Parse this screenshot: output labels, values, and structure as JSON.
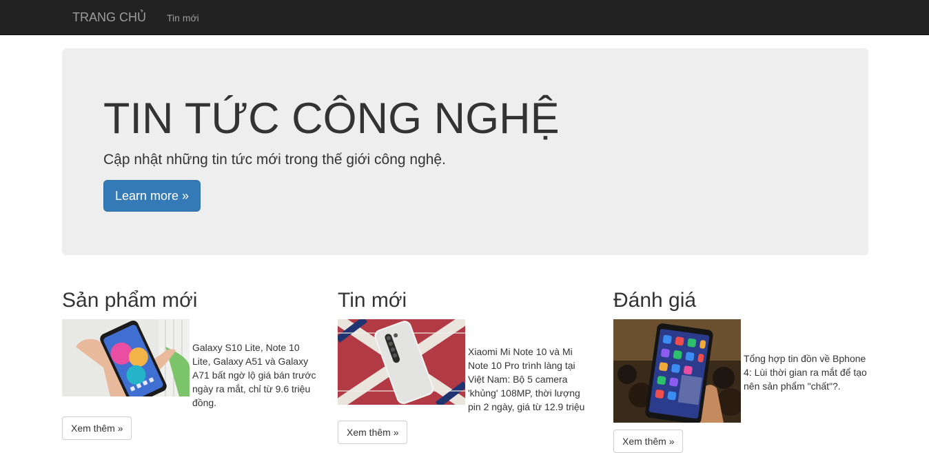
{
  "nav": {
    "brand": "TRANG CHỦ",
    "links": [
      "Tin mới"
    ]
  },
  "hero": {
    "title": "TIN TỨC CÔNG NGHỆ",
    "lead": "Cập nhật những tin tức mới trong thế giới công nghệ.",
    "button": "Learn more »"
  },
  "columns": [
    {
      "heading": "Sản phẩm mới",
      "text": "Galaxy S10 Lite, Note 10 Lite, Galaxy A51 và Galaxy A71 bất ngờ lộ giá bán trước ngày ra mắt, chỉ từ 9.6 triệu đồng.",
      "button": "Xem thêm »",
      "image_icon": "phone-in-hand-photo"
    },
    {
      "heading": "Tin mới",
      "text": "Xiaomi Mi Note 10 và Mi Note 10 Pro trình làng tại Việt Nam: Bộ 5 camera 'khủng' 108MP, thời lượng pin 2 ngày, giá từ 12.9 triệu",
      "button": "Xem thêm »",
      "image_icon": "phone-on-flag-photo"
    },
    {
      "heading": "Đánh giá",
      "text": "Tổng hợp tin đồn về Bphone 4: Lùi thời gian ra mắt để tạo nên sản phẩm \"chất\"?.",
      "button": "Xem thêm »",
      "image_icon": "phone-at-event-photo"
    }
  ],
  "colors": {
    "navbar": "#222222",
    "nav_text": "#9d9d9d",
    "jumbotron": "#eeeeee",
    "primary": "#337ab7"
  }
}
